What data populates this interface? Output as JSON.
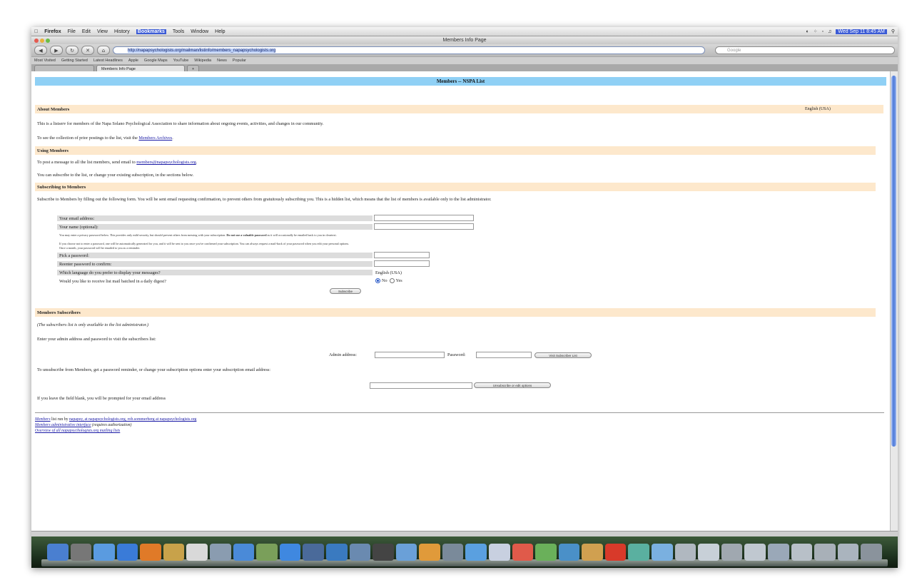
{
  "menubar": {
    "items": [
      "Firefox",
      "File",
      "Edit",
      "View",
      "History",
      "Bookmarks",
      "Tools",
      "Window",
      "Help"
    ],
    "selected_index": 5,
    "clock": "Wed Sep 11 8:45 AM"
  },
  "window": {
    "title": "Members Info Page"
  },
  "navbar": {
    "url": "http://napapsychologists.org/mailman/listinfo/members_napapsychologists.org",
    "search_placeholder": "Google"
  },
  "bookmarks": [
    "Most Visited",
    "Getting Started",
    "Latest Headlines",
    "Apple",
    "Google Maps",
    "YouTube",
    "Wikipedia",
    "News",
    "Popular"
  ],
  "tabs": [
    {
      "label": "Members Info Page"
    }
  ],
  "page": {
    "title": "Members -- NSPA List",
    "language_label": "English (USA)",
    "about": {
      "heading": "About Members",
      "text": "This is a listserv for members of the Napa Solano Psychological Association to share information about ongoing events, activities, and changes in our community.",
      "archive_prefix": "To see the collection of prior postings to the list, visit the",
      "archive_link": "Members Archives",
      "archive_suffix": "."
    },
    "using": {
      "heading": "Using Members",
      "post_prefix": "To post a message to all the list members, send email to",
      "post_email": "members@napapsychologists.org",
      "post_suffix": ".",
      "subscribe_text": "You can subscribe to the list, or change your existing subscription, in the sections below."
    },
    "subscribing": {
      "heading": "Subscribing to Members",
      "text": "Subscribe to Members by filling out the following form. You will be sent email requesting confirmation, to prevent others from gratuitously subscribing you. This is a hidden list, which means that the list of members is available only to the list administrator.",
      "email_label": "Your email address:",
      "name_label": "Your name (optional):",
      "note1a": "You may enter a privacy password below. This provides only mild security, but should prevent others from messing with your subscription.",
      "note1b": "Do not use a valuable password",
      "note1c": "as it will occasionally be emailed back to you in cleartext.",
      "note2": "If you choose not to enter a password, one will be automatically generated for you, and it will be sent to you once you've confirmed your subscription. You can always request a mail-back of your password when you edit your personal options.",
      "note3": "Once a month, your password will be emailed to you as a reminder.",
      "pick_label": "Pick a password:",
      "reenter_label": "Reenter password to confirm:",
      "language_q": "Which language do you prefer to display your messages?",
      "language_val": "English (USA)",
      "digest_q": "Would you like to receive list mail batched in a daily digest?",
      "no_label": "No",
      "yes_label": "Yes",
      "subscribe_btn": "Subscribe"
    },
    "subscribers": {
      "heading": "Members Subscribers",
      "note": "(The subscribers list is only available to the list administrator.)",
      "enter_text": "Enter your admin address and password to visit the subscribers list:",
      "admin_label": "Admin address:",
      "password_label": "Password:",
      "visit_btn": "Visit Subscriber List",
      "unsub_text": "To unsubscribe from Members, get a password reminder, or change your subscription options enter your subscription email address:",
      "unsub_btn": "Unsubscribe or edit options",
      "blank_text": "If you leave the field blank, you will be prompted for your email address"
    },
    "footer": {
      "list_name": "Members",
      "run_by": "list run by",
      "admins": "napapsy, at napapsychologists.org, rob.sommerberg at napapsychologists.org",
      "admin_iface": "Members administrative interface",
      "admin_iface_note": "(requires authorization)",
      "overview": "Overview of all napapsychologists.org mailing lists"
    }
  },
  "colors": {
    "page_header": "#8fd0f5",
    "section_bg": "#fde8cc",
    "link": "#1a1aa6"
  }
}
